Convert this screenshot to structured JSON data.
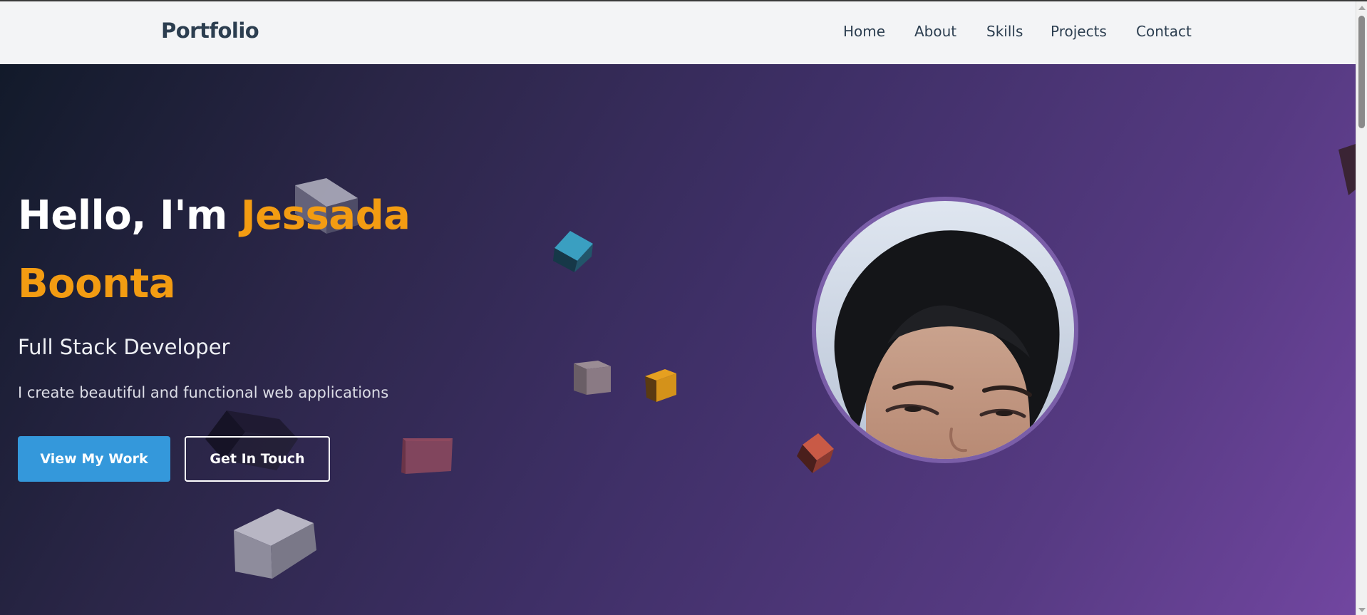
{
  "nav": {
    "brand": "Portfolio",
    "links": [
      {
        "label": "Home"
      },
      {
        "label": "About"
      },
      {
        "label": "Skills"
      },
      {
        "label": "Projects"
      },
      {
        "label": "Contact"
      }
    ]
  },
  "hero": {
    "greeting": "Hello, I'm ",
    "name": "Jessada Boonta",
    "role": "Full Stack Developer",
    "tagline": "I create beautiful and functional web applications",
    "primary_button": "View My Work",
    "secondary_button": "Get In Touch"
  },
  "colors": {
    "accent_orange": "#f39c12",
    "primary_blue": "#3498db",
    "nav_text": "#2c3e50"
  }
}
